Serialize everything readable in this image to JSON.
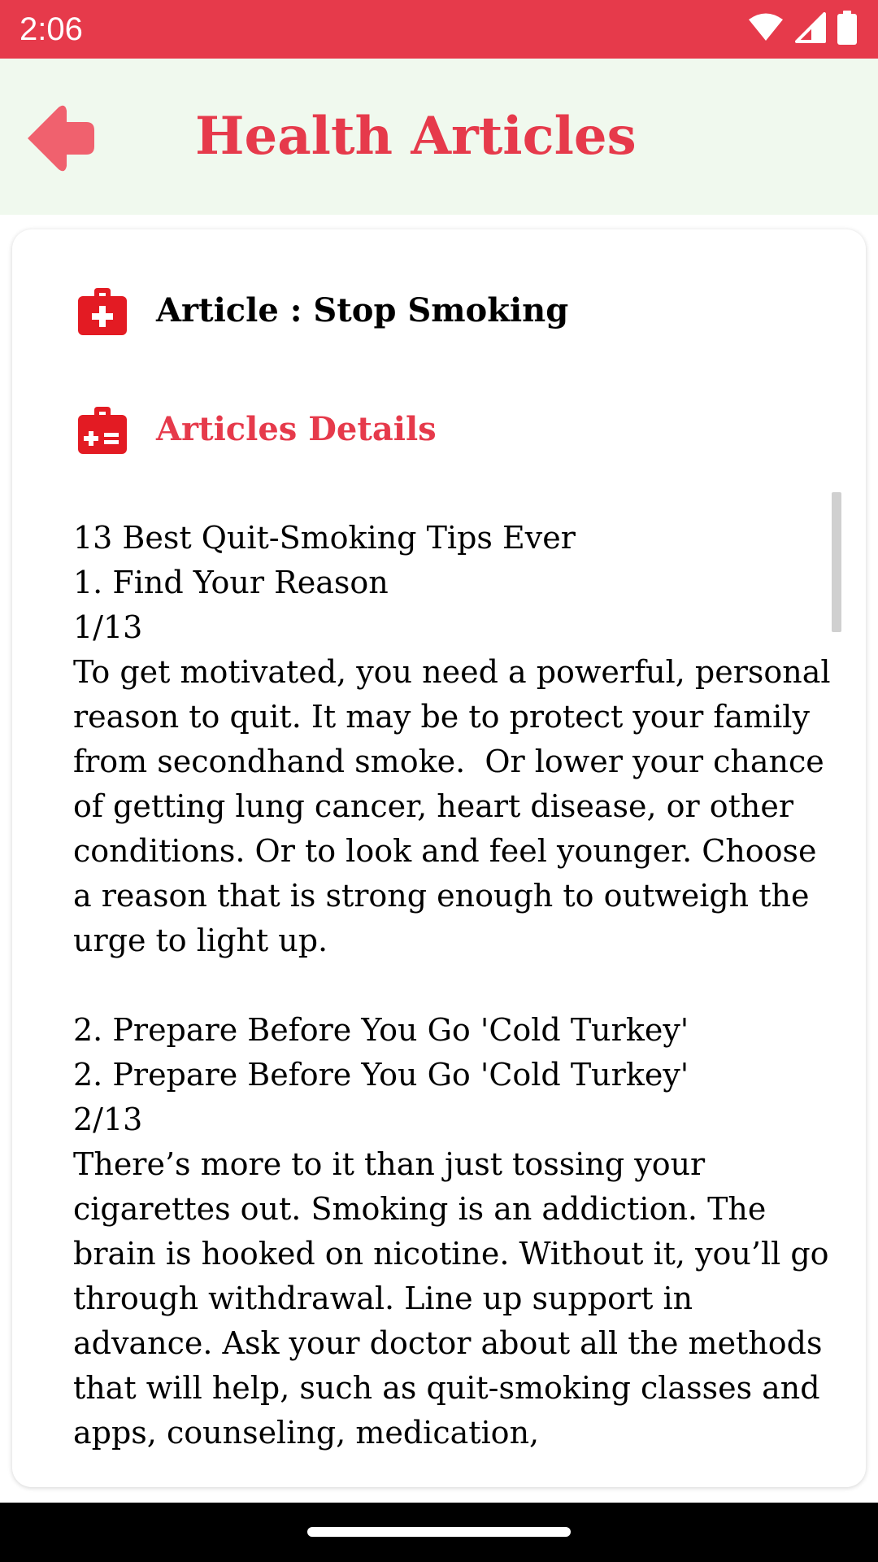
{
  "status_bar": {
    "time": "2:06",
    "icons": [
      "wifi-icon",
      "signal-icon",
      "battery-icon"
    ],
    "background": "#e63a4b"
  },
  "header": {
    "back_icon": "back-arrow-icon",
    "title": "Health Articles",
    "background": "#f0f9ee",
    "accent": "#e63a4b"
  },
  "article": {
    "title_icon": "first-aid-kit-icon",
    "title": "Article : Stop Smoking",
    "details_icon": "medical-kit-icon",
    "details_label": "Articles Details",
    "body": "13 Best Quit-Smoking Tips Ever\n1. Find Your Reason\n1/13\nTo get motivated, you need a powerful, personal reason to quit. It may be to protect your family from secondhand smoke.  Or lower your chance of getting lung cancer, heart disease, or other conditions. Or to look and feel younger. Choose a reason that is strong enough to outweigh the urge to light up.\n\n2. Prepare Before You Go 'Cold Turkey'\n2. Prepare Before You Go 'Cold Turkey'\n2/13\nThere’s more to it than just tossing your cigarettes out. Smoking is an addiction. The brain is hooked on nicotine. Without it, you’ll go through withdrawal. Line up support in advance. Ask your doctor about all the methods that will help, such as quit-smoking classes and apps, counseling, medication,"
  }
}
